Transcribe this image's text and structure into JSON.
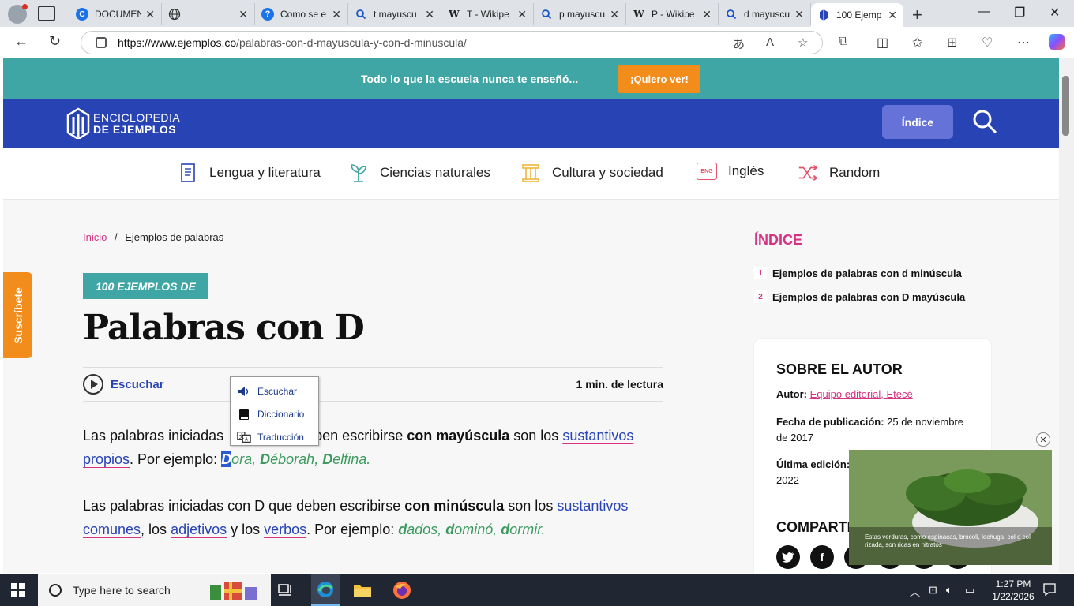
{
  "browser": {
    "tabs": [
      {
        "title": "DOCUMEN",
        "icon": "c-icon"
      },
      {
        "title": "",
        "icon": "globe-icon"
      },
      {
        "title": "Como se e",
        "icon": "help-icon"
      },
      {
        "title": "t mayuscu",
        "icon": "search-icon"
      },
      {
        "title": "T - Wikipe",
        "icon": "wikipedia-icon"
      },
      {
        "title": "p mayuscu",
        "icon": "search-icon"
      },
      {
        "title": "P - Wikipe",
        "icon": "wikipedia-icon"
      },
      {
        "title": "d mayuscu",
        "icon": "search-icon"
      },
      {
        "title": "100 Ejemp",
        "icon": "page-icon",
        "active": true
      }
    ],
    "url_host": "https://www.ejemplos.co",
    "url_path": "/palabras-con-d-mayuscula-y-con-d-minuscula/"
  },
  "promo": {
    "text": "Todo lo que la escuela nunca te enseñó...",
    "button": "¡Quiero ver!"
  },
  "header": {
    "logo_line1": "ENCICLOPEDIA",
    "logo_line2": "DE EJEMPLOS",
    "index_button": "Índice"
  },
  "categories": [
    {
      "label": "Lengua y literatura",
      "icon": "book-icon"
    },
    {
      "label": "Ciencias naturales",
      "icon": "plant-icon"
    },
    {
      "label": "Cultura y sociedad",
      "icon": "column-icon"
    },
    {
      "label": "Inglés",
      "icon": "eng-icon",
      "badge": "ENG"
    },
    {
      "label": "Random",
      "icon": "shuffle-icon"
    }
  ],
  "breadcrumb": {
    "home": "Inicio",
    "sep": "/",
    "current": "Ejemplos de palabras"
  },
  "article": {
    "badge": "100 EJEMPLOS DE",
    "title": "Palabras con D",
    "listen": "Escuchar",
    "read_time": "1 min. de lectura",
    "p1_a": "Las palabras iniciadas ",
    "p1_b": "deben escribirse ",
    "p1_bold": "con mayúscula",
    "p1_c": " son los ",
    "p1_link": "sustantivos propios",
    "p1_d": ". Por ejemplo: ",
    "p1_sel": "D",
    "p1_ex1": "ora, ",
    "p1_ex2b": "D",
    "p1_ex2": "éborah, ",
    "p1_ex3b": "D",
    "p1_ex3": "elfina.",
    "p2_a": "Las palabras iniciadas con D que deben escribirse ",
    "p2_bold": "con minúscula",
    "p2_c": " son los ",
    "p2_link1": "sustantivos comunes",
    "p2_d": ", los ",
    "p2_link2": "adjetivos",
    "p2_e": " y los ",
    "p2_link3": "verbos",
    "p2_f": ". Por ejemplo: ",
    "p2_ex1b": "d",
    "p2_ex1": "ados, ",
    "p2_ex2b": "d",
    "p2_ex2": "ominó, ",
    "p2_ex3b": "d",
    "p2_ex3": "ormir."
  },
  "context_menu": {
    "items": [
      {
        "label": "Escuchar",
        "icon": "speaker-icon"
      },
      {
        "label": "Diccionario",
        "icon": "dictionary-icon"
      },
      {
        "label": "Traducción",
        "icon": "translate-icon"
      }
    ]
  },
  "subscribe": "Suscríbete",
  "toc": {
    "title": "ÍNDICE",
    "items": [
      {
        "n": "1",
        "label": "Ejemplos de palabras con d minúscula"
      },
      {
        "n": "2",
        "label": "Ejemplos de palabras con D mayúscula"
      }
    ]
  },
  "author_card": {
    "title": "SOBRE EL AUTOR",
    "author_label": "Autor:",
    "author_value": "Equipo editorial, Etecé",
    "pub_label": "Fecha de publicación:",
    "pub_value": "25 de noviembre de 2017",
    "edit_label": "Última edición:",
    "edit_value": "2022",
    "share": "COMPARTI"
  },
  "ad": {
    "caption": "Estas verduras, como espinacas, brócoli, lechuga, col o col rizada, son ricas en nitratos",
    "close": "✕"
  },
  "taskbar": {
    "search_placeholder": "Type here to search",
    "time": "1:27 PM",
    "date": "1/22/2026"
  }
}
